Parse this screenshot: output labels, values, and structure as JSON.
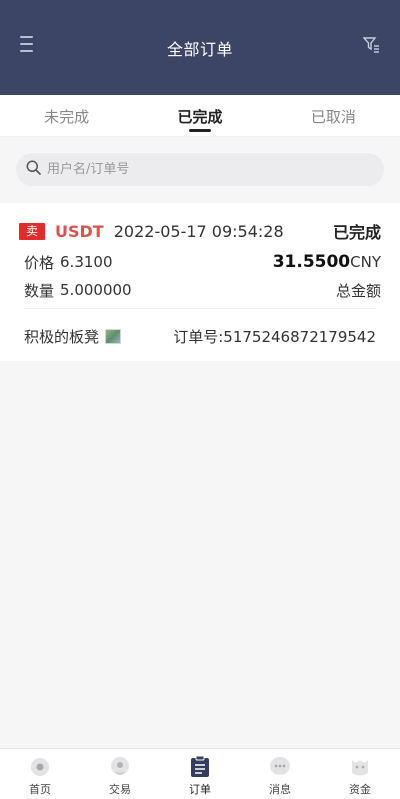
{
  "header": {
    "title": "全部订单"
  },
  "tabs": [
    {
      "label": "未完成",
      "active": false
    },
    {
      "label": "已完成",
      "active": true
    },
    {
      "label": "已取消",
      "active": false
    }
  ],
  "search": {
    "placeholder": "用户名/订单号",
    "value": ""
  },
  "orders": [
    {
      "side": "卖",
      "coin": "USDT",
      "time": "2022-05-17 09:54:28",
      "status": "已完成",
      "price_label": "价格",
      "price": "6.3100",
      "qty_label": "数量",
      "qty": "5.000000",
      "total": "31.5500",
      "currency": "CNY",
      "total_label": "总金额",
      "merchant": "积极的板凳",
      "order_no_label": "订单号:",
      "order_no": "517524687217954​2"
    }
  ],
  "tabbar": [
    {
      "label": "首页",
      "icon": "home-icon"
    },
    {
      "label": "交易",
      "icon": "trade-icon"
    },
    {
      "label": "订单",
      "icon": "orders-icon",
      "active": true
    },
    {
      "label": "消息",
      "icon": "message-icon"
    },
    {
      "label": "资金",
      "icon": "wallet-icon"
    }
  ],
  "colors": {
    "header_bg": "#3c4566",
    "sell_tag": "#e52a2a",
    "coin": "#d9534f"
  }
}
